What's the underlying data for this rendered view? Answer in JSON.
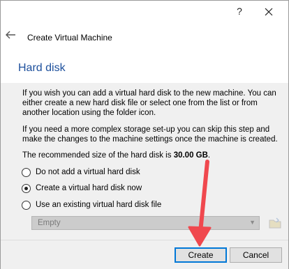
{
  "window": {
    "help_glyph": "?",
    "close_icon": "close-icon"
  },
  "header": {
    "back_icon": "back-arrow-icon",
    "dialog_title": "Create Virtual Machine",
    "section_title": "Hard disk"
  },
  "content": {
    "paragraph1": "If you wish you can add a virtual hard disk to the new machine. You can either create a new hard disk file or select one from the list or from another location using the folder icon.",
    "paragraph2": "If you need a more complex storage set-up you can skip this step and make the changes to the machine settings once the machine is created.",
    "recommend_prefix": "The recommended size of the hard disk is ",
    "recommend_size": "30.00 GB",
    "recommend_suffix": "."
  },
  "options": [
    {
      "label": "Do not add a virtual hard disk",
      "checked": false
    },
    {
      "label": "Create a virtual hard disk now",
      "checked": true
    },
    {
      "label": "Use an existing virtual hard disk file",
      "checked": false
    }
  ],
  "disk_select": {
    "value": "Empty",
    "disabled": true
  },
  "footer": {
    "create_label": "Create",
    "cancel_label": "Cancel"
  },
  "annotation": {
    "arrow_color": "#f0484e"
  }
}
